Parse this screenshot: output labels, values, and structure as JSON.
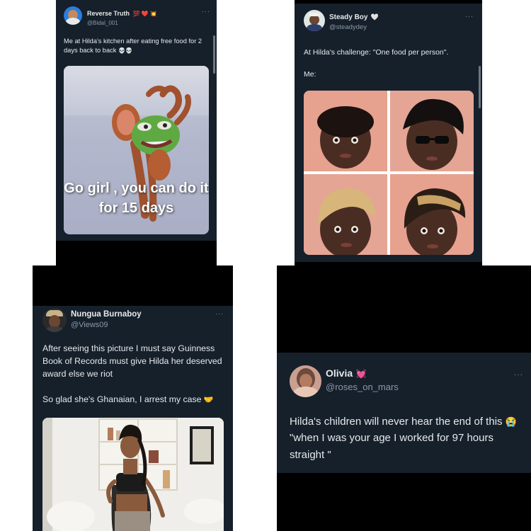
{
  "post1": {
    "name": "Reverse Truth",
    "name_emojis": "💯 ❤️ 💥",
    "handle": "@Bidal_001",
    "more": "···",
    "text": "Me at Hilda's kitchen after eating free food for 2 days back to back",
    "text_emoji": "💀💀",
    "meme_caption": "Go girl , you can do it for 15 days",
    "meme_icon": "frog-face-dancing-mouse-meme"
  },
  "post2": {
    "name": "Steady Boy",
    "name_emoji": "🤍",
    "handle": "@steadydey",
    "more": "···",
    "text_line1": "At Hilda's challenge: \"One food per person\".",
    "text_line2": "Me:",
    "grid_icon": "four-baby-photo-grid"
  },
  "post3": {
    "name": "Nungua Burnaboy",
    "handle": "@Views09",
    "more": "···",
    "text_para1": "After seeing this picture I must say Guinness Book of Records must give Hilda her deserved award else we riot",
    "text_para2": "So glad she's Ghanaian, I arrest my case",
    "text_emoji": "🤝",
    "photo_icon": "woman-posing-in-room-photo"
  },
  "post4": {
    "name": "Olivia",
    "name_emoji": "💓",
    "handle": "@roses_on_mars",
    "more": "···",
    "text_part1": "Hilda's children will never hear the end of this",
    "text_emoji": "😭",
    "text_part2": "\"when I was your age I worked for 97 hours straight \""
  },
  "colors": {
    "card_bg": "#15202b",
    "page_bg": "#ffffff",
    "black_band": "#000000",
    "text": "#e7e9ea",
    "muted": "#8b98a5"
  }
}
